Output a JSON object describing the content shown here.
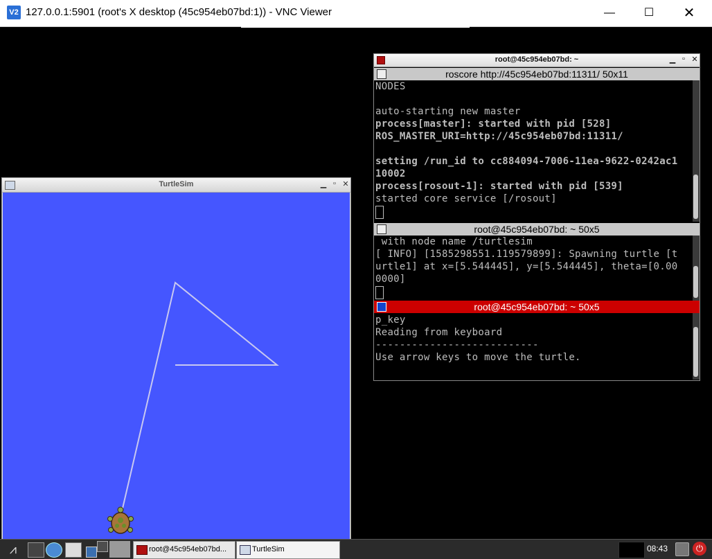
{
  "vnc": {
    "title": "127.0.0.1:5901 (root's X desktop (45c954eb07bd:1)) - VNC Viewer",
    "logo": "V2",
    "controls": {
      "minimize": "—",
      "maximize": "☐",
      "close": "✕"
    }
  },
  "turtlesim": {
    "title": "TurtleSim",
    "controls": {
      "minimize": "▁",
      "maximize": "▫",
      "close": "✕"
    },
    "background_color": "#4556ff",
    "trail_color": "#c8c8f0",
    "turtle_icon": "turtle-icon"
  },
  "terminal": {
    "title": "root@45c954eb07bd: ~",
    "controls": {
      "minimize": "▁",
      "maximize": "▫",
      "close": "✕"
    },
    "panes": [
      {
        "header": "roscore http://45c954eb07bd:11311/ 50x11",
        "active": false,
        "lines": [
          {
            "text": "NODES",
            "bold": false
          },
          {
            "text": "",
            "bold": false
          },
          {
            "text": "auto-starting new master",
            "bold": false
          },
          {
            "text": "process[master]: started with pid [528]",
            "bold": true
          },
          {
            "text": "ROS_MASTER_URI=http://45c954eb07bd:11311/",
            "bold": true
          },
          {
            "text": "",
            "bold": false
          },
          {
            "text": "setting /run_id to cc884094-7006-11ea-9622-0242ac1",
            "bold": true
          },
          {
            "text": "10002",
            "bold": true
          },
          {
            "text": "process[rosout-1]: started with pid [539]",
            "bold": true
          },
          {
            "text": "started core service [/rosout]",
            "bold": false
          }
        ]
      },
      {
        "header": "root@45c954eb07bd: ~ 50x5",
        "active": false,
        "lines": [
          {
            "text": " with node name /turtlesim",
            "bold": false
          },
          {
            "text": "[ INFO] [1585298551.119579899]: Spawning turtle [t",
            "bold": false
          },
          {
            "text": "urtle1] at x=[5.544445], y=[5.544445], theta=[0.00",
            "bold": false
          },
          {
            "text": "0000]",
            "bold": false
          }
        ]
      },
      {
        "header": "root@45c954eb07bd: ~ 50x5",
        "active": true,
        "lines": [
          {
            "text": "p_key",
            "bold": false
          },
          {
            "text": "Reading from keyboard",
            "bold": false
          },
          {
            "text": "---------------------------",
            "bold": false
          },
          {
            "text": "Use arrow keys to move the turtle.",
            "bold": false
          }
        ]
      }
    ]
  },
  "taskbar": {
    "menu_icon": "⩘",
    "tasks": [
      {
        "label": "root@45c954eb07bd..."
      },
      {
        "label": "TurtleSim"
      }
    ],
    "clock": "08:43",
    "power_icon": "⏻"
  }
}
